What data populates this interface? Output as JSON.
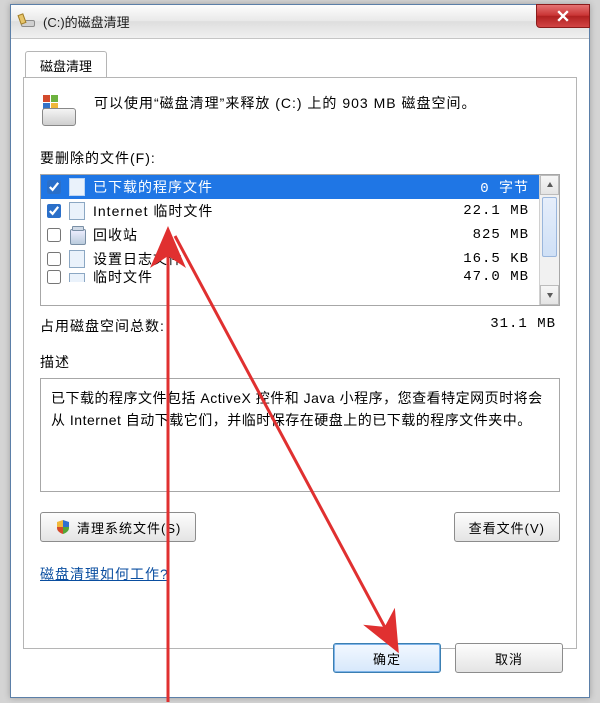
{
  "window": {
    "title": "(C:)的磁盘清理",
    "tab_label": "磁盘清理",
    "close_icon": "close"
  },
  "intro": {
    "text": "可以使用“磁盘清理”来释放  (C:) 上的 903 MB 磁盘空间。"
  },
  "delete_section": {
    "label": "要删除的文件(F):"
  },
  "file_list": [
    {
      "checked": true,
      "icon": "doc",
      "name": "已下载的程序文件",
      "size": "0 字节",
      "selected": true
    },
    {
      "checked": true,
      "icon": "doc",
      "name": "Internet 临时文件",
      "size": "22.1 MB",
      "selected": false
    },
    {
      "checked": false,
      "icon": "bin",
      "name": "回收站",
      "size": "825 MB",
      "selected": false
    },
    {
      "checked": false,
      "icon": "doc",
      "name": "设置日志文件",
      "size": "16.5 KB",
      "selected": false
    },
    {
      "checked": false,
      "icon": "doc",
      "name": "临时文件",
      "size": "47.0 MB",
      "selected": false,
      "cut": true
    }
  ],
  "total": {
    "label": "占用磁盘空间总数:",
    "value": "31.1 MB"
  },
  "description": {
    "label": "描述",
    "text": "已下载的程序文件包括 ActiveX 控件和 Java 小程序，您查看特定网页时将会从 Internet 自动下载它们，并临时保存在硬盘上的已下载的程序文件夹中。"
  },
  "buttons": {
    "clean_system": "清理系统文件(S)",
    "view_files": "查看文件(V)",
    "ok": "确定",
    "cancel": "取消"
  },
  "help_link": "磁盘清理如何工作?",
  "colors": {
    "selection": "#1f76e5",
    "link": "#0a4ea0",
    "close_button": "#c93434",
    "arrow": "#e03030"
  }
}
